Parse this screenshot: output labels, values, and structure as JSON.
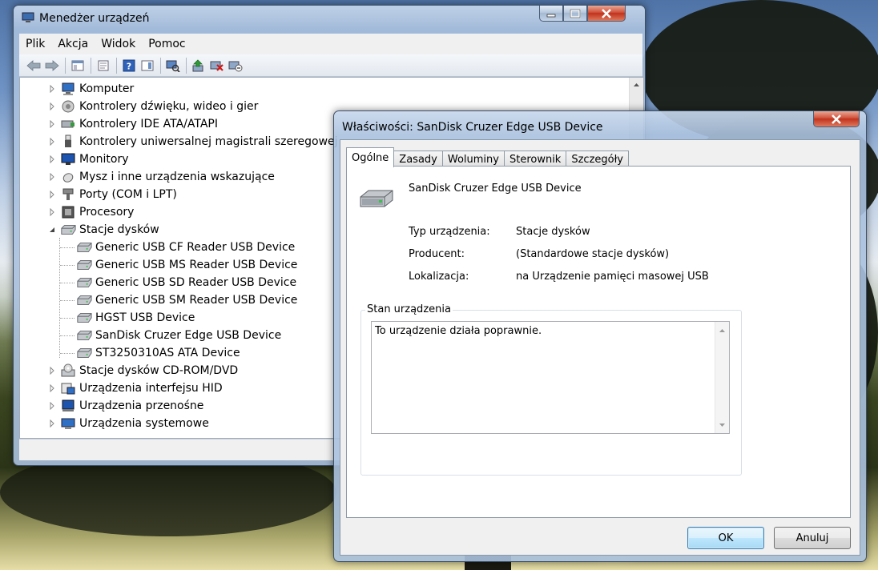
{
  "colors": {
    "accent": "#3c7fb1",
    "close_button": "#c2321c",
    "window_frame": "#aac1de"
  },
  "device_manager": {
    "title": "Menedżer urządzeń",
    "menu": [
      "Plik",
      "Akcja",
      "Widok",
      "Pomoc"
    ],
    "toolbar_icons": [
      "back-arrow-icon",
      "forward-arrow-icon",
      "show-hide-console-tree-icon",
      "properties-icon",
      "help-icon",
      "action-pane-icon",
      "scan-hardware-icon",
      "update-driver-icon",
      "uninstall-icon",
      "disable-icon"
    ],
    "tree": [
      {
        "label": "Komputer",
        "icon": "computer-icon",
        "level": 0,
        "expanded": false
      },
      {
        "label": "Kontrolery dźwięku, wideo i gier",
        "icon": "speaker-icon",
        "level": 0,
        "expanded": false
      },
      {
        "label": "Kontrolery IDE ATA/ATAPI",
        "icon": "ide-controller-icon",
        "level": 0,
        "expanded": false
      },
      {
        "label": "Kontrolery uniwersalnej magistrali szeregowej",
        "icon": "usb-plug-icon",
        "level": 0,
        "expanded": false
      },
      {
        "label": "Monitory",
        "icon": "monitor-icon",
        "level": 0,
        "expanded": false
      },
      {
        "label": "Mysz i inne urządzenia wskazujące",
        "icon": "mouse-icon",
        "level": 0,
        "expanded": false
      },
      {
        "label": "Porty (COM i LPT)",
        "icon": "port-icon",
        "level": 0,
        "expanded": false
      },
      {
        "label": "Procesory",
        "icon": "processor-icon",
        "level": 0,
        "expanded": false
      },
      {
        "label": "Stacje dysków",
        "icon": "disk-drive-icon",
        "level": 0,
        "expanded": true
      },
      {
        "label": "Generic USB CF Reader USB Device",
        "icon": "disk-drive-icon",
        "level": 1
      },
      {
        "label": "Generic USB MS Reader USB Device",
        "icon": "disk-drive-icon",
        "level": 1
      },
      {
        "label": "Generic USB SD Reader USB Device",
        "icon": "disk-drive-icon",
        "level": 1
      },
      {
        "label": "Generic USB SM Reader USB Device",
        "icon": "disk-drive-icon",
        "level": 1
      },
      {
        "label": "HGST USB Device",
        "icon": "disk-drive-icon",
        "level": 1
      },
      {
        "label": "SanDisk Cruzer Edge USB Device",
        "icon": "disk-drive-icon",
        "level": 1
      },
      {
        "label": "ST3250310AS ATA Device",
        "icon": "disk-drive-icon",
        "level": 1
      },
      {
        "label": "Stacje dysków CD-ROM/DVD",
        "icon": "cd-drive-icon",
        "level": 0,
        "expanded": false
      },
      {
        "label": "Urządzenia interfejsu HID",
        "icon": "hid-icon",
        "level": 0,
        "expanded": false
      },
      {
        "label": "Urządzenia przenośne",
        "icon": "portable-device-icon",
        "level": 0,
        "expanded": false
      },
      {
        "label": "Urządzenia systemowe",
        "icon": "system-device-icon",
        "level": 0,
        "expanded": false
      }
    ]
  },
  "properties_dialog": {
    "title": "Właściwości: SanDisk Cruzer Edge USB Device",
    "tabs": [
      "Ogólne",
      "Zasady",
      "Woluminy",
      "Sterownik",
      "Szczegóły"
    ],
    "active_tab": "Ogólne",
    "device_name": "SanDisk Cruzer Edge USB Device",
    "fields": [
      {
        "label": "Typ urządzenia:",
        "value": "Stacje dysków"
      },
      {
        "label": "Producent:",
        "value": "(Standardowe stacje dysków)"
      },
      {
        "label": "Lokalizacja:",
        "value": "na Urządzenie pamięci masowej USB"
      }
    ],
    "status_group_title": "Stan urządzenia",
    "status_text": "To urządzenie działa poprawnie.",
    "ok_label": "OK",
    "cancel_label": "Anuluj"
  }
}
